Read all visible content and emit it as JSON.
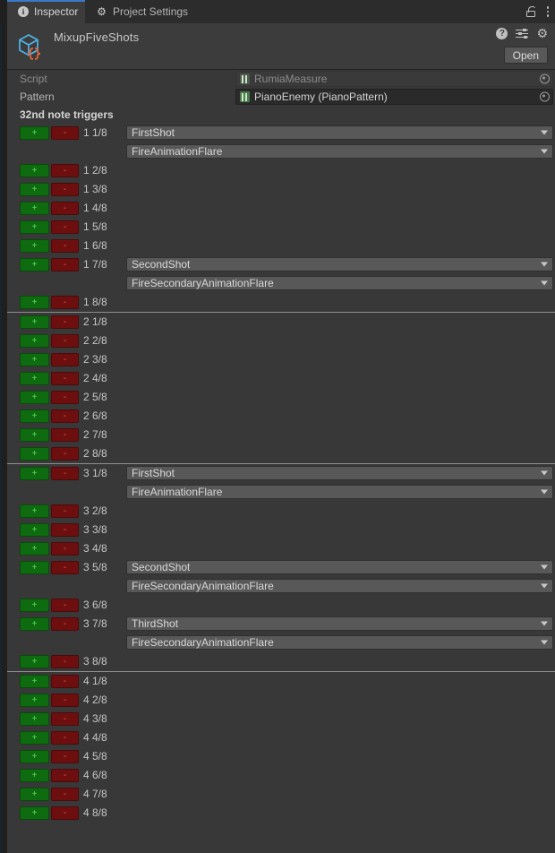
{
  "window": {
    "tabs": [
      {
        "label": "Inspector",
        "icon": "info-icon",
        "active": true
      },
      {
        "label": "Project Settings",
        "icon": "gear-icon",
        "active": false
      }
    ],
    "lock_icon": "lock-icon",
    "menu_icon": "kebab-menu-icon"
  },
  "header": {
    "title": "MixupFiveShots",
    "object_icon": "scriptable-object-icon",
    "help_icon": "help-icon",
    "preset_icon": "preset-icon",
    "settings_icon": "gear-icon",
    "open_label": "Open"
  },
  "properties": [
    {
      "label": "Script",
      "value": "RumiaMeasure",
      "icon": "script-asset-icon",
      "disabled": true,
      "picker_icon": "object-picker-icon"
    },
    {
      "label": "Pattern",
      "value": "PianoEnemy (PianoPattern)",
      "icon": "script-asset-icon",
      "disabled": false,
      "picker_icon": "object-picker-icon"
    }
  ],
  "triggers": {
    "section_label": "32nd note triggers",
    "add_label": "+",
    "remove_label": "-",
    "dropdown_arrow_icon": "chevron-down-icon",
    "measures": [
      {
        "rows": [
          {
            "note": "1 1/8",
            "shot": "FirstShot",
            "effect": "FireAnimationFlare"
          },
          {
            "note": "1 2/8",
            "shot": null,
            "effect": null
          },
          {
            "note": "1 3/8",
            "shot": null,
            "effect": null
          },
          {
            "note": "1 4/8",
            "shot": null,
            "effect": null
          },
          {
            "note": "1 5/8",
            "shot": null,
            "effect": null
          },
          {
            "note": "1 6/8",
            "shot": null,
            "effect": null
          },
          {
            "note": "1 7/8",
            "shot": "SecondShot",
            "effect": "FireSecondaryAnimationFlare"
          },
          {
            "note": "1 8/8",
            "shot": null,
            "effect": null
          }
        ]
      },
      {
        "rows": [
          {
            "note": "2 1/8",
            "shot": null,
            "effect": null
          },
          {
            "note": "2 2/8",
            "shot": null,
            "effect": null
          },
          {
            "note": "2 3/8",
            "shot": null,
            "effect": null
          },
          {
            "note": "2 4/8",
            "shot": null,
            "effect": null
          },
          {
            "note": "2 5/8",
            "shot": null,
            "effect": null
          },
          {
            "note": "2 6/8",
            "shot": null,
            "effect": null
          },
          {
            "note": "2 7/8",
            "shot": null,
            "effect": null
          },
          {
            "note": "2 8/8",
            "shot": null,
            "effect": null
          }
        ]
      },
      {
        "rows": [
          {
            "note": "3 1/8",
            "shot": "FirstShot",
            "effect": "FireAnimationFlare"
          },
          {
            "note": "3 2/8",
            "shot": null,
            "effect": null
          },
          {
            "note": "3 3/8",
            "shot": null,
            "effect": null
          },
          {
            "note": "3 4/8",
            "shot": null,
            "effect": null
          },
          {
            "note": "3 5/8",
            "shot": "SecondShot",
            "effect": "FireSecondaryAnimationFlare"
          },
          {
            "note": "3 6/8",
            "shot": null,
            "effect": null
          },
          {
            "note": "3 7/8",
            "shot": "ThirdShot",
            "effect": "FireSecondaryAnimationFlare"
          },
          {
            "note": "3 8/8",
            "shot": null,
            "effect": null
          }
        ]
      },
      {
        "rows": [
          {
            "note": "4 1/8",
            "shot": null,
            "effect": null
          },
          {
            "note": "4 2/8",
            "shot": null,
            "effect": null
          },
          {
            "note": "4 3/8",
            "shot": null,
            "effect": null
          },
          {
            "note": "4 4/8",
            "shot": null,
            "effect": null
          },
          {
            "note": "4 5/8",
            "shot": null,
            "effect": null
          },
          {
            "note": "4 6/8",
            "shot": null,
            "effect": null
          },
          {
            "note": "4 7/8",
            "shot": null,
            "effect": null
          },
          {
            "note": "4 8/8",
            "shot": null,
            "effect": null
          }
        ]
      }
    ]
  },
  "colors": {
    "accent_tab": "#3a79c8",
    "window_bg": "#383838",
    "header_bg": "#3c3c3c",
    "tabbar_bg": "#2c2c2c",
    "add_button": "#0e6b10",
    "remove_button": "#6e0f0f",
    "dropdown_bg": "#585858",
    "divider": "#8e8e8e"
  }
}
